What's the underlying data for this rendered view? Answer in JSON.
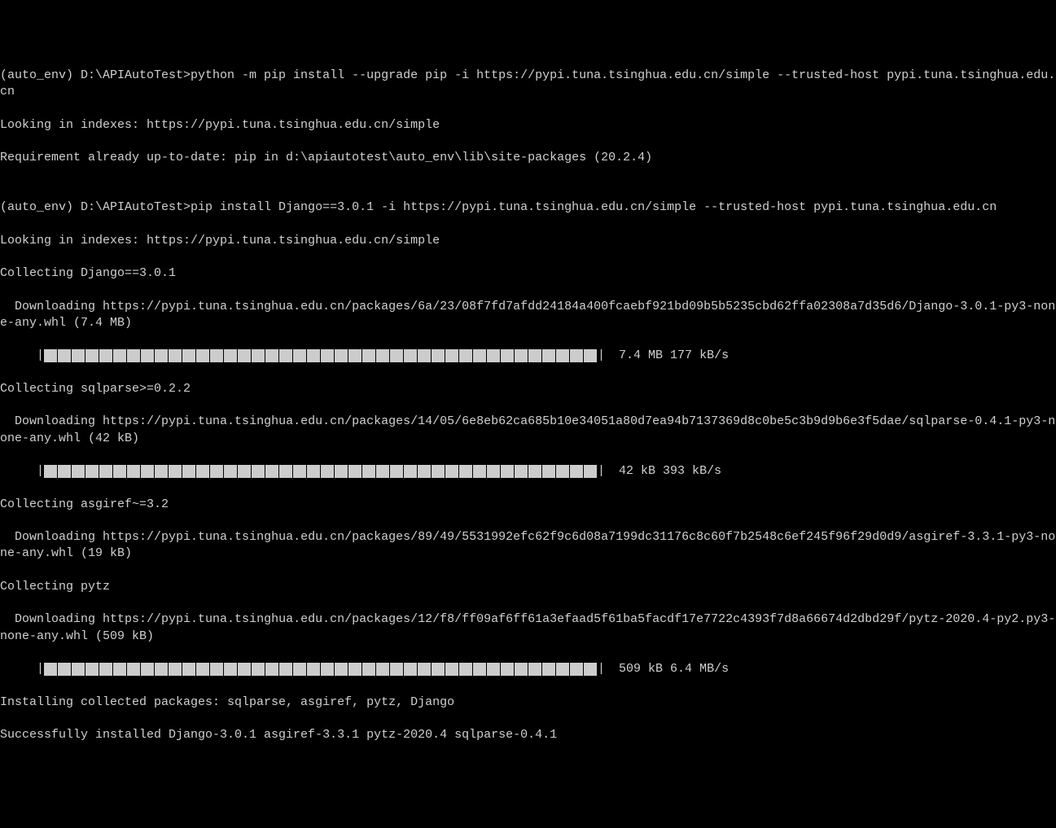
{
  "lines": {
    "l1": "(auto_env) D:\\APIAutoTest>python -m pip install --upgrade pip -i https://pypi.tuna.tsinghua.edu.cn/simple --trusted-host pypi.tuna.tsinghua.edu.cn",
    "l2": "Looking in indexes: https://pypi.tuna.tsinghua.edu.cn/simple",
    "l3": "Requirement already up-to-date: pip in d:\\apiautotest\\auto_env\\lib\\site-packages (20.2.4)",
    "l4": "",
    "l5": "(auto_env) D:\\APIAutoTest>pip install Django==3.0.1 -i https://pypi.tuna.tsinghua.edu.cn/simple --trusted-host pypi.tuna.tsinghua.edu.cn",
    "l6": "Looking in indexes: https://pypi.tuna.tsinghua.edu.cn/simple",
    "l7": "Collecting Django==3.0.1",
    "l8": "  Downloading https://pypi.tuna.tsinghua.edu.cn/packages/6a/23/08f7fd7afdd24184a400fcaebf921bd09b5b5235cbd62ffa02308a7d35d6/Django-3.0.1-py3-none-any.whl (7.4 MB)",
    "p1_indent": "     |",
    "p1_text": " 7.4 MB 177 kB/s",
    "l9": "Collecting sqlparse>=0.2.2",
    "l10": "  Downloading https://pypi.tuna.tsinghua.edu.cn/packages/14/05/6e8eb62ca685b10e34051a80d7ea94b7137369d8c0be5c3b9d9b6e3f5dae/sqlparse-0.4.1-py3-none-any.whl (42 kB)",
    "p2_indent": "     |",
    "p2_text": " 42 kB 393 kB/s",
    "l11": "Collecting asgiref~=3.2",
    "l12": "  Downloading https://pypi.tuna.tsinghua.edu.cn/packages/89/49/5531992efc62f9c6d08a7199dc31176c8c60f7b2548c6ef245f96f29d0d9/asgiref-3.3.1-py3-none-any.whl (19 kB)",
    "l13": "Collecting pytz",
    "l14": "  Downloading https://pypi.tuna.tsinghua.edu.cn/packages/12/f8/ff09af6ff61a3efaad5f61ba5facdf17e7722c4393f7d8a66674d2dbd29f/pytz-2020.4-py2.py3-none-any.whl (509 kB)",
    "p3_indent": "     |",
    "p3_text": " 509 kB 6.4 MB/s",
    "l15": "Installing collected packages: sqlparse, asgiref, pytz, Django",
    "l16": "Successfully installed Django-3.0.1 asgiref-3.3.1 pytz-2020.4 sqlparse-0.4.1"
  },
  "progress_blocks": 40
}
